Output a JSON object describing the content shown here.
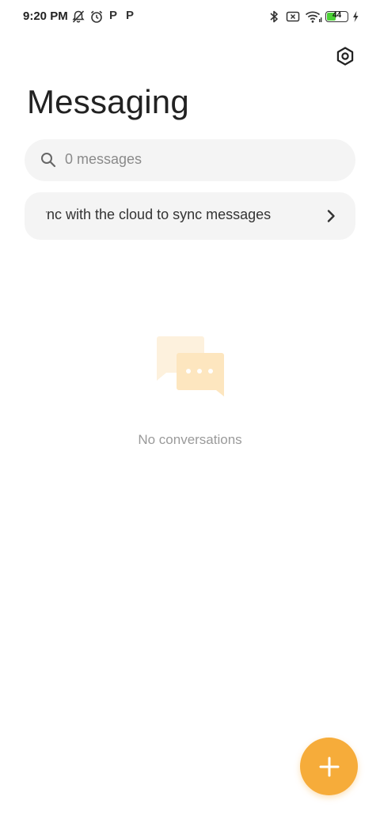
{
  "status_bar": {
    "time": "9:20 PM",
    "battery_level": "44",
    "battery_fraction": 0.44,
    "battery_color": "#4cd137",
    "icons": [
      "notifications-off-icon",
      "alarm-icon",
      "p-app-icon",
      "p-app-icon",
      "bluetooth-icon",
      "no-sim-icon",
      "wifi-icon",
      "battery-icon",
      "charging-icon"
    ],
    "p_label": "P"
  },
  "header": {
    "title": "Messaging",
    "settings_icon": "settings-icon"
  },
  "search": {
    "placeholder": "0 messages",
    "icon": "search-icon"
  },
  "cloud_banner": {
    "text": "Sync with the cloud to sync messages",
    "icon": "chevron-right-icon"
  },
  "empty_state": {
    "text": "No conversations",
    "icon": "chat-bubbles-icon"
  },
  "fab": {
    "icon": "plus-icon",
    "color": "#f6ac3a"
  }
}
